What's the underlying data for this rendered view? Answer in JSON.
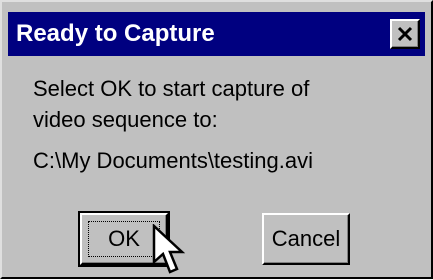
{
  "window": {
    "title": "Ready to Capture",
    "close_icon": "close-icon"
  },
  "message": {
    "line1": "Select OK to start capture of",
    "line2": "video sequence to:",
    "path": "C:\\My Documents\\testing.avi"
  },
  "buttons": {
    "ok_label": "OK",
    "cancel_label": "Cancel"
  },
  "colors": {
    "titlebar": "#000080",
    "face": "#c0c0c0",
    "title_text": "#ffffff"
  },
  "cursor_icon": "arrow-pointer-icon"
}
